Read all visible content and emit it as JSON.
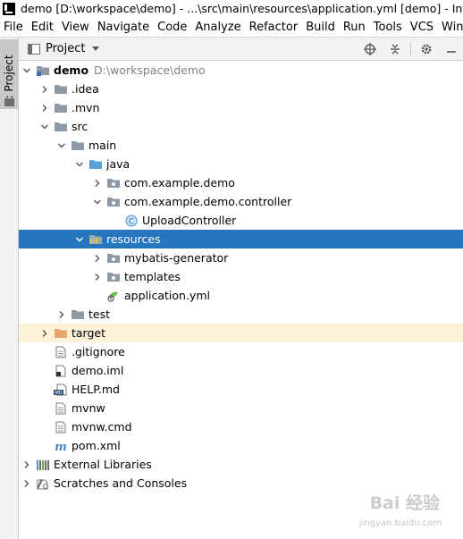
{
  "window": {
    "title": "demo [D:\\workspace\\demo] - ...\\src\\main\\resources\\application.yml [demo] - IntelliJ"
  },
  "menu": [
    "File",
    "Edit",
    "View",
    "Navigate",
    "Code",
    "Analyze",
    "Refactor",
    "Build",
    "Run",
    "Tools",
    "VCS",
    "Windo"
  ],
  "toolstrip": {
    "project_tab": "1: Project"
  },
  "project_panel": {
    "title": "Project"
  },
  "tree": [
    {
      "label": "demo",
      "path": "D:\\workspace\\demo",
      "bold": true,
      "expanded": true,
      "icon": "module-folder-icon"
    },
    {
      "label": ".idea",
      "expanded": false,
      "icon": "folder-icon"
    },
    {
      "label": ".mvn",
      "expanded": false,
      "icon": "folder-icon"
    },
    {
      "label": "src",
      "expanded": true,
      "icon": "folder-icon"
    },
    {
      "label": "main",
      "expanded": true,
      "icon": "folder-icon"
    },
    {
      "label": "java",
      "expanded": true,
      "icon": "source-root-folder-icon"
    },
    {
      "label": "com.example.demo",
      "expanded": false,
      "icon": "package-icon"
    },
    {
      "label": "com.example.demo.controller",
      "expanded": true,
      "icon": "package-icon"
    },
    {
      "label": "UploadController",
      "icon": "java-class-icon"
    },
    {
      "label": "resources",
      "expanded": true,
      "icon": "resources-folder-icon",
      "selected": true
    },
    {
      "label": "mybatis-generator",
      "expanded": false,
      "icon": "package-icon"
    },
    {
      "label": "templates",
      "expanded": false,
      "icon": "package-icon"
    },
    {
      "label": "application.yml",
      "icon": "yaml-file-icon"
    },
    {
      "label": "test",
      "expanded": false,
      "icon": "folder-icon"
    },
    {
      "label": "target",
      "expanded": false,
      "icon": "excluded-folder-icon",
      "excluded": true
    },
    {
      "label": ".gitignore",
      "icon": "text-file-icon"
    },
    {
      "label": "demo.iml",
      "icon": "iml-file-icon"
    },
    {
      "label": "HELP.md",
      "icon": "markdown-file-icon"
    },
    {
      "label": "mvnw",
      "icon": "text-file-icon"
    },
    {
      "label": "mvnw.cmd",
      "icon": "text-file-icon"
    },
    {
      "label": "pom.xml",
      "icon": "maven-file-icon"
    },
    {
      "label": "External Libraries",
      "expanded": false,
      "icon": "libraries-icon"
    },
    {
      "label": "Scratches and Consoles",
      "expanded": false,
      "icon": "scratches-icon"
    }
  ],
  "watermark": {
    "text": "Bai 经验",
    "sub": "jingyan.baidu.com"
  },
  "colors": {
    "selection": "#2675bf",
    "excluded_bg": "#fdf1d8",
    "folder": "#8d99a6",
    "excluded_folder": "#e8a46b",
    "source_folder": "#5aa3d6"
  }
}
